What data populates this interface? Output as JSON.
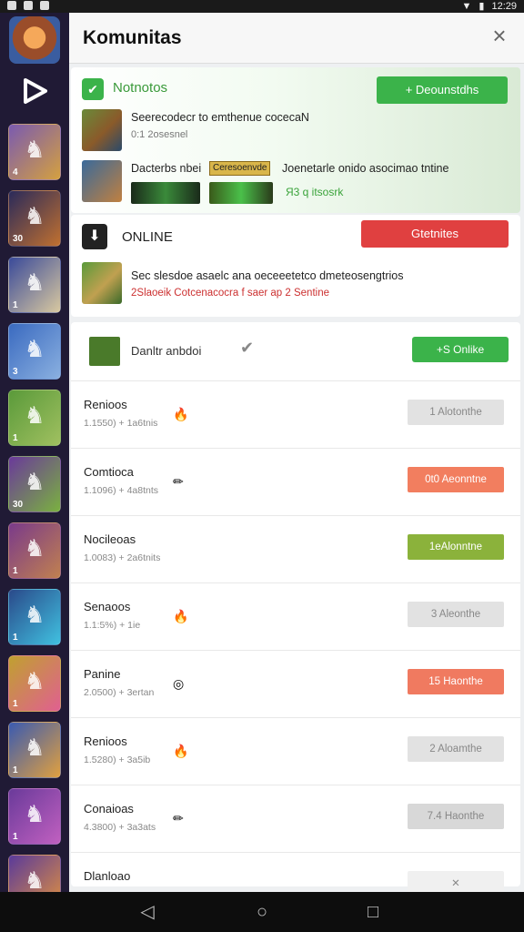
{
  "status": {
    "time": "12:29"
  },
  "panel": {
    "title": "Komunitas"
  },
  "notifications": {
    "label": "Notnotos",
    "button": "+ Deounstdhs",
    "items": [
      {
        "text": "Seerecodecr to emthenue cocecaN",
        "sub": "0:1 2osesnel"
      },
      {
        "text": "Dacterbs nbei",
        "tag": "Ceresoenvde",
        "text2": "Joenetarle onido asocimao tntine",
        "sub": "Я3 q itsosrk"
      }
    ]
  },
  "online": {
    "label": "ONLINE",
    "button": "Gtetnites",
    "item": {
      "text": "Sec slesdoe asaelc ana oeceeetetco dmeteosengtrios",
      "sub": "2Slaoeik Cotcenacocra f saer ap 2 Sentine"
    }
  },
  "list": {
    "first": {
      "name": "Danltr anbdoi",
      "button": "+S Onlike"
    },
    "rows": [
      {
        "name": "Renioos",
        "meta": "1.1550) + 1a6tnis",
        "emoji": "🔥",
        "button": "1 Alotonthe",
        "color": "#e2e2e2"
      },
      {
        "name": "Comtioca",
        "meta": "1.1096) + 4a8tnts",
        "emoji": "✏",
        "button": "0t0 Aeonntne",
        "color": "#f27e5f"
      },
      {
        "name": "Nocileoas",
        "meta": "1.0083) + 2a6tnits",
        "emoji": "",
        "button": "1eAlonntne",
        "color": "#8bb23b"
      },
      {
        "name": "Senaoos",
        "meta": "1.1:5%) + 1ie",
        "emoji": "🔥",
        "button": "3 Aleonthe",
        "color": "#e2e2e2"
      },
      {
        "name": "Panine",
        "meta": "2.0500) + 3ertan",
        "emoji": "◎",
        "button": "15 Haonthe",
        "color": "#f07a60"
      },
      {
        "name": "Renioos",
        "meta": "1.5280) + 3a5ib",
        "emoji": "🔥",
        "button": "2 Aloamthe",
        "color": "#e2e2e2"
      },
      {
        "name": "Conaioas",
        "meta": "4.3800) + 3a3ats",
        "emoji": "✏",
        "button": "7.4 Haonthe",
        "color": "#d8d8d8"
      },
      {
        "name": "Dlanloao",
        "meta": "",
        "emoji": "",
        "button": "✕",
        "color": "#f0f0f0"
      }
    ]
  },
  "tiles": [
    {
      "num": "4",
      "c1": "#7a5ab0",
      "c2": "#d4a040"
    },
    {
      "num": "30",
      "c1": "#2a2a5a",
      "c2": "#c07030"
    },
    {
      "num": "1",
      "c1": "#3a4a9a",
      "c2": "#d8c8a0"
    },
    {
      "num": "3",
      "c1": "#3a6ac0",
      "c2": "#8ab0e0"
    },
    {
      "num": "1",
      "c1": "#5a9a3a",
      "c2": "#a0c060"
    },
    {
      "num": "30",
      "c1": "#6a3a9a",
      "c2": "#7ab040"
    },
    {
      "num": "1",
      "c1": "#7a3a8a",
      "c2": "#c08050"
    },
    {
      "num": "1",
      "c1": "#2a4a8a",
      "c2": "#40c0e0"
    },
    {
      "num": "1",
      "c1": "#c0a030",
      "c2": "#e06090"
    },
    {
      "num": "1",
      "c1": "#3a5ab0",
      "c2": "#e0a040"
    },
    {
      "num": "1",
      "c1": "#6a3a9a",
      "c2": "#c060c0"
    },
    {
      "num": "",
      "c1": "#5a3a9a",
      "c2": "#e09040"
    }
  ]
}
